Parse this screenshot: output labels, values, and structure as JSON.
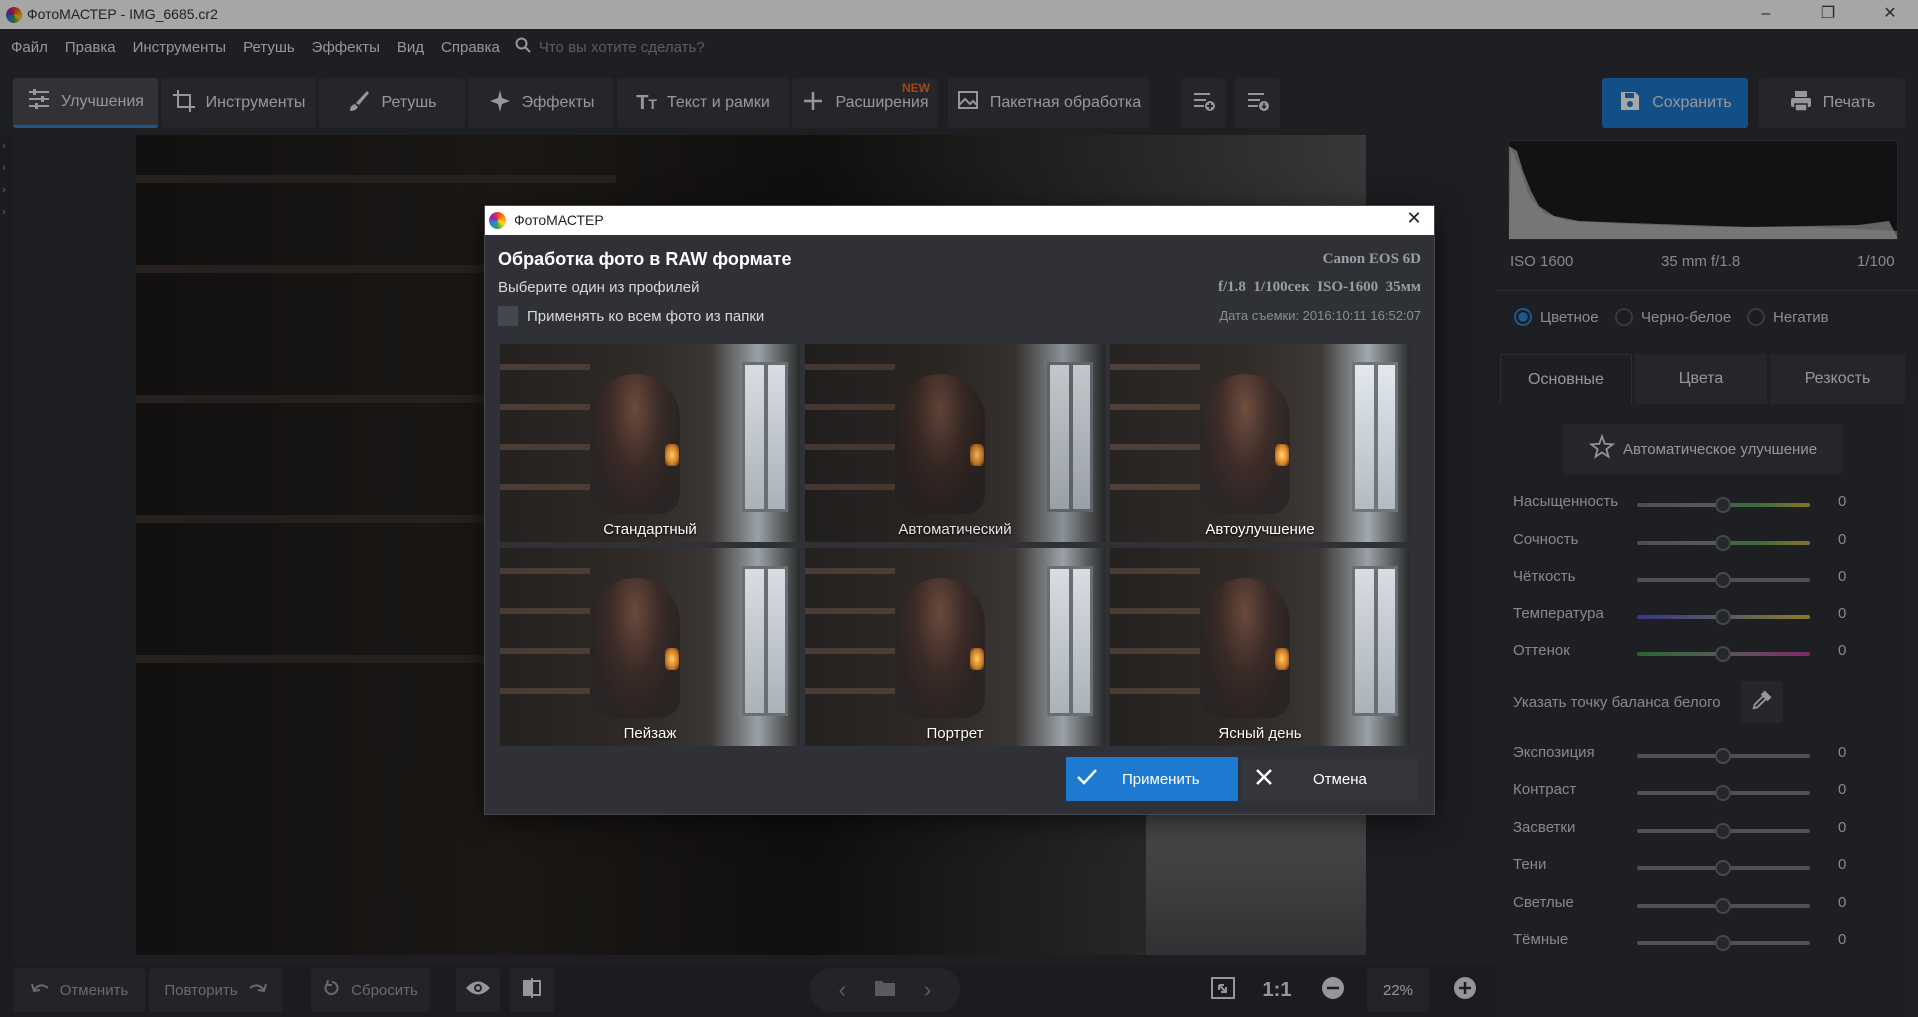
{
  "window": {
    "title": "ФотоМАСТЕР - IMG_6685.cr2"
  },
  "menu": {
    "items": [
      "Файл",
      "Правка",
      "Инструменты",
      "Ретушь",
      "Эффекты",
      "Вид",
      "Справка"
    ],
    "search_placeholder": "Что вы хотите сделать?"
  },
  "toolbar": {
    "tabs": [
      {
        "label": "Улучшения",
        "icon": "sliders-icon",
        "active": true
      },
      {
        "label": "Инструменты",
        "icon": "crop-icon"
      },
      {
        "label": "Ретушь",
        "icon": "brush-icon"
      },
      {
        "label": "Эффекты",
        "icon": "sparkle-icon"
      },
      {
        "label": "Текст и рамки",
        "icon": "text-icon"
      },
      {
        "label": "Расширения",
        "icon": "plus-icon",
        "badge": "NEW"
      },
      {
        "label": "Пакетная обработка",
        "icon": "images-icon"
      }
    ],
    "save_label": "Сохранить",
    "print_label": "Печать"
  },
  "histogram": {
    "iso": "ISO 1600",
    "lens": "35 mm f/1.8",
    "shutter": "1/100"
  },
  "mode": {
    "options": [
      "Цветное",
      "Черно-белое",
      "Негатив"
    ],
    "selected": "Цветное"
  },
  "panel_tabs": {
    "items": [
      "Основные",
      "Цвета",
      "Резкость"
    ],
    "active": "Основные"
  },
  "auto_button": "Автоматическое улучшение",
  "sliders_group1": [
    {
      "label": "Насыщенность",
      "value": "0"
    },
    {
      "label": "Сочность",
      "value": "0"
    },
    {
      "label": "Чёткость",
      "value": "0"
    },
    {
      "label": "Температура",
      "value": "0"
    },
    {
      "label": "Оттенок",
      "value": "0"
    }
  ],
  "white_balance_label": "Указать точку баланса белого",
  "sliders_group2": [
    {
      "label": "Экспозиция",
      "value": "0"
    },
    {
      "label": "Контраст",
      "value": "0"
    },
    {
      "label": "Засветки",
      "value": "0"
    },
    {
      "label": "Тени",
      "value": "0"
    },
    {
      "label": "Светлые",
      "value": "0"
    },
    {
      "label": "Тёмные",
      "value": "0"
    }
  ],
  "bottom": {
    "undo": "Отменить",
    "redo": "Повторить",
    "reset": "Сбросить",
    "ratio": "1:1",
    "zoom": "22%"
  },
  "dialog": {
    "title": "ФотоМАСТЕР",
    "heading": "Обработка фото в RAW формате",
    "camera": "Canon EOS 6D",
    "subtitle": "Выберите один из профилей",
    "exposure": "f/1.8  1/100сек  ISO-1600  35мм",
    "apply_all": "Применять ко всем фото из папки",
    "date": "Дата съемки: 2016:10:11 16:52:07",
    "profiles": [
      "Стандартный",
      "Автоматический",
      "Автоулучшение",
      "Пейзаж",
      "Портрет",
      "Ясный день"
    ],
    "apply_label": "Применить",
    "cancel_label": "Отмена"
  },
  "colors": {
    "accent": "#1e7ad0",
    "new_badge": "#ff6b1a",
    "panel_bg": "#2f3136"
  }
}
